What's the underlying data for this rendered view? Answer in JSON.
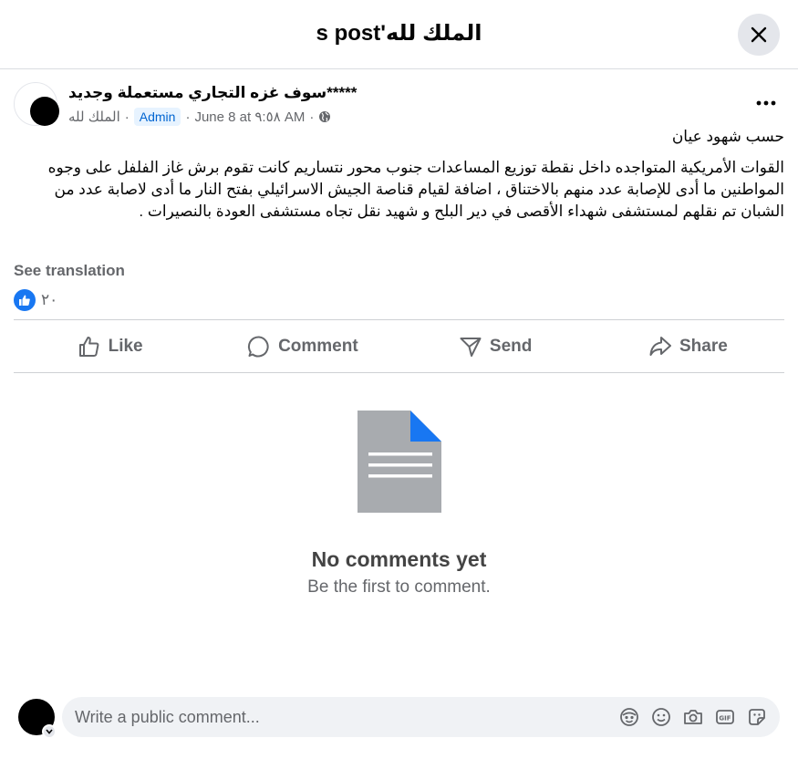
{
  "dialog": {
    "title": "الملك لله's post"
  },
  "post": {
    "author": "*****سوف غزه التجاري مستعملة وجديد",
    "author_page": "الملك لله",
    "role_badge": "Admin",
    "timestamp": "June 8 at ٩:٥٨ AM",
    "privacy_icon": "globe-icon",
    "paragraphs": [
      "حسب شهود عيان",
      "القوات الأمريكية المتواجده داخل نقطة توزيع المساعدات جنوب محور نتساريم كانت تقوم برش غاز الفلفل على وجوه المواطنين ما أدى للإصابة عدد منهم بالاختناق ، اضافة لقيام قناصة الجيش الاسرائيلي بفتح النار ما أدى لاصابة عدد من الشبان تم نقلهم لمستشفى شهداء الأقصى في دير البلح و شهيد نقل تجاه مستشفى العودة بالنصيرات ."
    ],
    "see_translation": "See translation",
    "reaction_count": "٢٠"
  },
  "actions": {
    "like": "Like",
    "comment": "Comment",
    "send": "Send",
    "share": "Share"
  },
  "empty_state": {
    "title": "No comments yet",
    "subtitle": "Be the first to comment."
  },
  "composer": {
    "placeholder": "Write a public comment..."
  },
  "colors": {
    "accent": "#1877f2",
    "doc_gray": "#a8abaf"
  }
}
